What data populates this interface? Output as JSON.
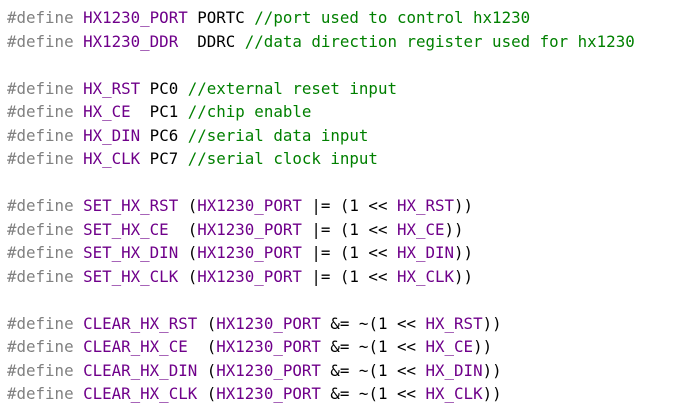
{
  "colors": {
    "directive": "#808080",
    "macro": "#6f008a",
    "comment": "#008000",
    "text": "#000000",
    "background": "#ffffff"
  },
  "lines": [
    {
      "kw": "#define",
      "sp1": " ",
      "mac": "HX1230_PORT",
      "rest": " PORTC ",
      "cmt": "//port used to control hx1230"
    },
    {
      "kw": "#define",
      "sp1": " ",
      "mac": "HX1230_DDR",
      "rest": "  DDRC ",
      "cmt": "//data direction register used for hx1230"
    },
    null,
    {
      "kw": "#define",
      "sp1": " ",
      "mac": "HX_RST",
      "rest": " PC0 ",
      "cmt": "//external reset input"
    },
    {
      "kw": "#define",
      "sp1": " ",
      "mac": "HX_CE",
      "rest": "  PC1 ",
      "cmt": "//chip enable"
    },
    {
      "kw": "#define",
      "sp1": " ",
      "mac": "HX_DIN",
      "rest": " PC6 ",
      "cmt": "//serial data input"
    },
    {
      "kw": "#define",
      "sp1": " ",
      "mac": "HX_CLK",
      "rest": " PC7 ",
      "cmt": "//serial clock input"
    },
    null,
    {
      "kw": "#define",
      "sp1": " ",
      "mac": "SET_HX_RST",
      "rest": " (",
      "mac2": "HX1230_PORT",
      "rest2": " |= (1 << ",
      "mac3": "HX_RST",
      "rest3": "))"
    },
    {
      "kw": "#define",
      "sp1": " ",
      "mac": "SET_HX_CE",
      "rest": "  (",
      "mac2": "HX1230_PORT",
      "rest2": " |= (1 << ",
      "mac3": "HX_CE",
      "rest3": "))"
    },
    {
      "kw": "#define",
      "sp1": " ",
      "mac": "SET_HX_DIN",
      "rest": " (",
      "mac2": "HX1230_PORT",
      "rest2": " |= (1 << ",
      "mac3": "HX_DIN",
      "rest3": "))"
    },
    {
      "kw": "#define",
      "sp1": " ",
      "mac": "SET_HX_CLK",
      "rest": " (",
      "mac2": "HX1230_PORT",
      "rest2": " |= (1 << ",
      "mac3": "HX_CLK",
      "rest3": "))"
    },
    null,
    {
      "kw": "#define",
      "sp1": " ",
      "mac": "CLEAR_HX_RST",
      "rest": " (",
      "mac2": "HX1230_PORT",
      "rest2": " &= ~(1 << ",
      "mac3": "HX_RST",
      "rest3": "))"
    },
    {
      "kw": "#define",
      "sp1": " ",
      "mac": "CLEAR_HX_CE",
      "rest": "  (",
      "mac2": "HX1230_PORT",
      "rest2": " &= ~(1 << ",
      "mac3": "HX_CE",
      "rest3": "))"
    },
    {
      "kw": "#define",
      "sp1": " ",
      "mac": "CLEAR_HX_DIN",
      "rest": " (",
      "mac2": "HX1230_PORT",
      "rest2": " &= ~(1 << ",
      "mac3": "HX_DIN",
      "rest3": "))"
    },
    {
      "kw": "#define",
      "sp1": " ",
      "mac": "CLEAR_HX_CLK",
      "rest": " (",
      "mac2": "HX1230_PORT",
      "rest2": " &= ~(1 << ",
      "mac3": "HX_CLK",
      "rest3": "))"
    }
  ]
}
